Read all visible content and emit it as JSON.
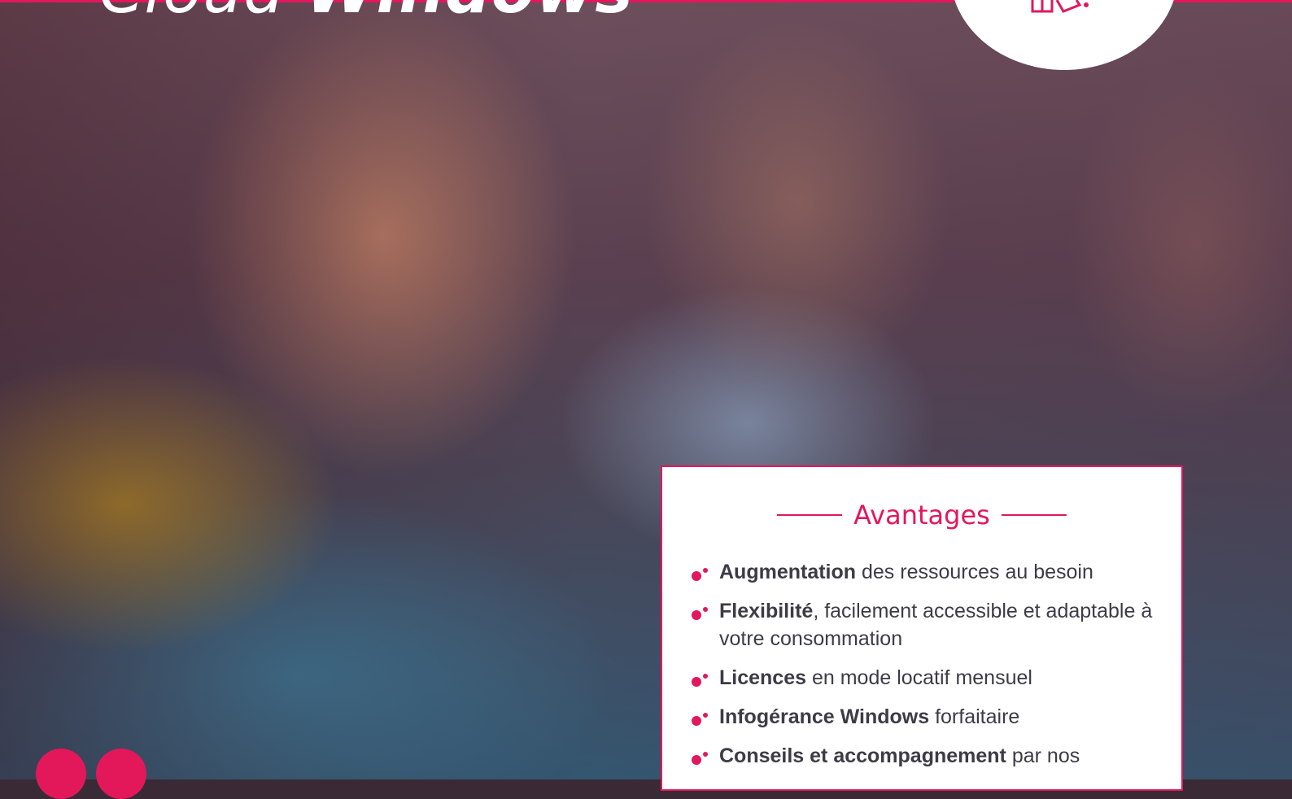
{
  "headline": {
    "light": "Cloud",
    "bold": "Windows"
  },
  "card": {
    "title": "Avantages",
    "items": [
      {
        "bold": "Augmentation",
        "rest": " des ressources au besoin"
      },
      {
        "bold": "Flexibilité",
        "rest": ", facilement accessible et adaptable à votre consommation"
      },
      {
        "bold": "Licences",
        "rest": " en mode locatif mensuel"
      },
      {
        "bold": "Infogérance Windows",
        "rest": " forfaitaire"
      },
      {
        "bold": "Conseils et accompagnement",
        "rest": " par nos"
      }
    ]
  },
  "colors": {
    "accent": "#e2185b",
    "text": "#3c3c46"
  },
  "icons": {
    "badge": "documents-icon",
    "bullet": "bullet-dots-icon"
  }
}
